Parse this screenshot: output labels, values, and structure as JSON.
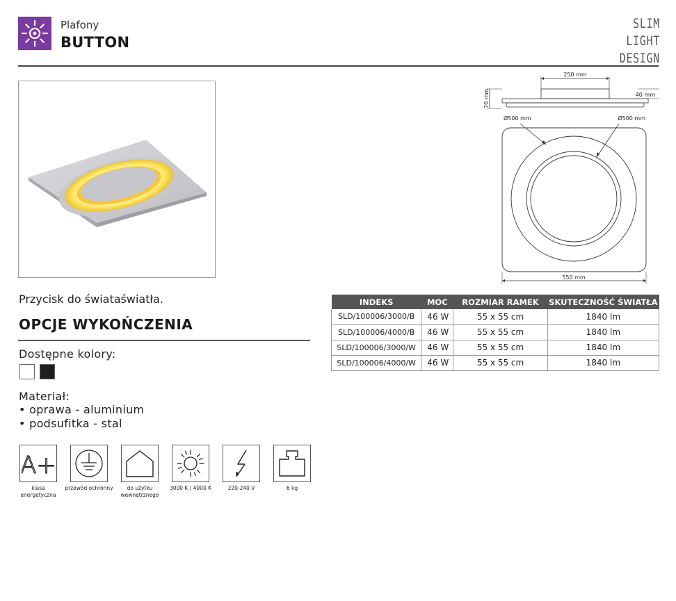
{
  "header": {
    "category": "Plafony",
    "product": "BUTTON",
    "brand_line1": "SLIM LIGHT",
    "brand_line2": "DESIGN",
    "logo_icon": "sun-icon",
    "logo_color": "#7a3aa0"
  },
  "drawing": {
    "width_top": "250 mm",
    "depth_right": "40 mm",
    "height_left": "70 mm",
    "diameter_left": "Ø500 mm",
    "diameter_right": "Ø500 mm",
    "width_bottom": "550 mm"
  },
  "description": "Przycisk do świataświatła.",
  "options": {
    "title": "OPCJE WYKOŃCZENIA",
    "colors_label": "Dostępne kolory:",
    "colors": [
      "#ffffff",
      "#1e1e1e"
    ],
    "material_label": "Materiał:",
    "materials": [
      "• oprawa - aluminium",
      "• podsufitka - stal"
    ]
  },
  "table": {
    "headers": [
      "INDEKS",
      "MOC",
      "ROZMIAR RAMEK",
      "SKUTECZNOŚĆ ŚWIATŁA"
    ],
    "rows": [
      [
        "SLD/100006/3000/B",
        "46 W",
        "55 x 55 cm",
        "1840 lm"
      ],
      [
        "SLD/100006/4000/B",
        "46 W",
        "55 x 55 cm",
        "1840 lm"
      ],
      [
        "SLD/100006/3000/W",
        "46 W",
        "55 x 55 cm",
        "1840 lm"
      ],
      [
        "SLD/100006/4000/W",
        "46 W",
        "55 x 55 cm",
        "1840 lm"
      ]
    ]
  },
  "features": [
    {
      "icon": "energy-class-icon",
      "label": "A+",
      "caption": "klasa energetyczna"
    },
    {
      "icon": "ground-icon",
      "caption": "przewód ochronny"
    },
    {
      "icon": "indoor-house-icon",
      "caption": "do użytku wewnętrznego"
    },
    {
      "icon": "sun-icon",
      "caption": "3000 K | 4000 K"
    },
    {
      "icon": "lightning-icon",
      "caption": "220-240 V"
    },
    {
      "icon": "weight-icon",
      "caption": "6 kg"
    }
  ]
}
